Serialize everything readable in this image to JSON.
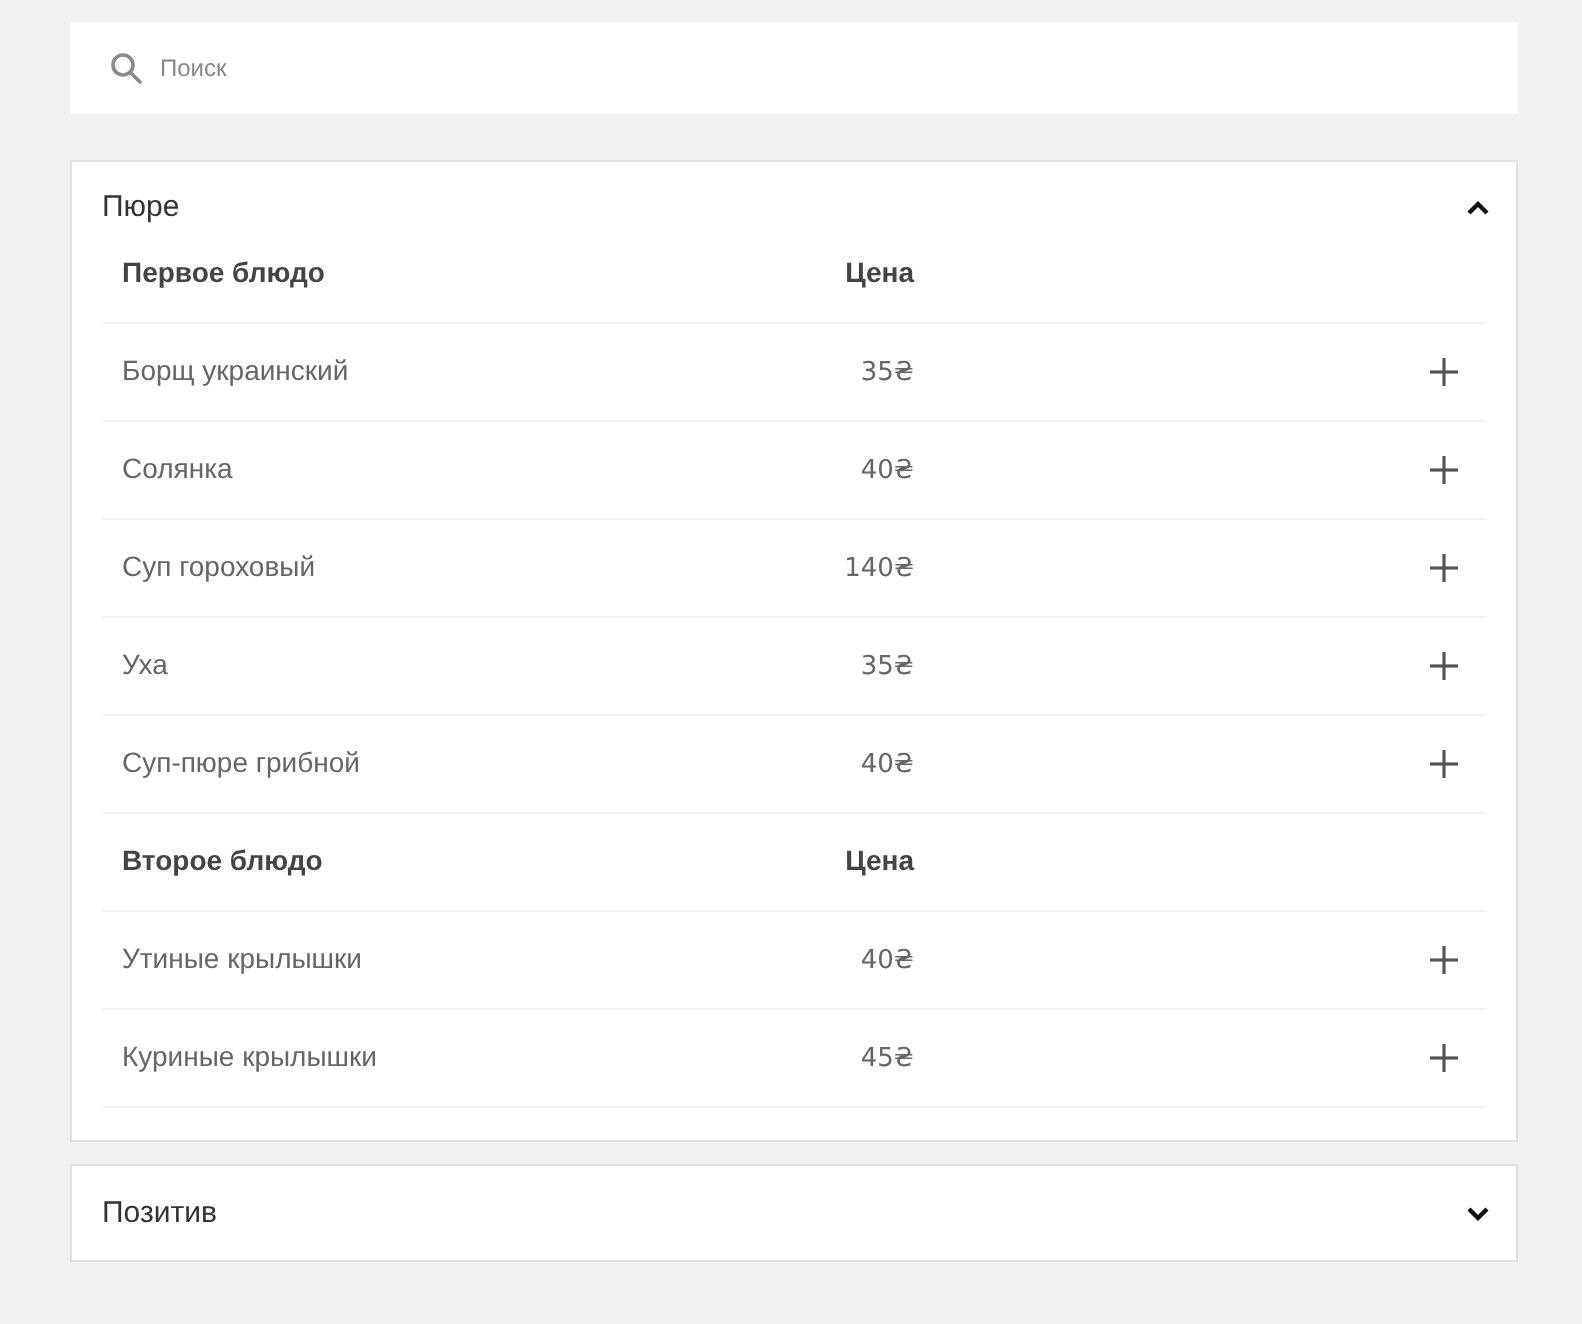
{
  "search": {
    "placeholder": "Поиск"
  },
  "sections": [
    {
      "title": "Пюре",
      "expanded": true,
      "groups": [
        {
          "heading": "Первое блюдо",
          "price_heading": "Цена",
          "items": [
            {
              "name": "Борщ украинский",
              "price": "35₴"
            },
            {
              "name": "Солянка",
              "price": "40₴"
            },
            {
              "name": "Суп гороховый",
              "price": "140₴"
            },
            {
              "name": "Уха",
              "price": "35₴"
            },
            {
              "name": "Суп-пюре грибной",
              "price": "40₴"
            }
          ]
        },
        {
          "heading": "Второе блюдо",
          "price_heading": "Цена",
          "items": [
            {
              "name": "Утиные крылышки",
              "price": "40₴"
            },
            {
              "name": "Куриные крылышки",
              "price": "45₴"
            }
          ]
        }
      ]
    },
    {
      "title": "Позитив",
      "expanded": false
    }
  ]
}
